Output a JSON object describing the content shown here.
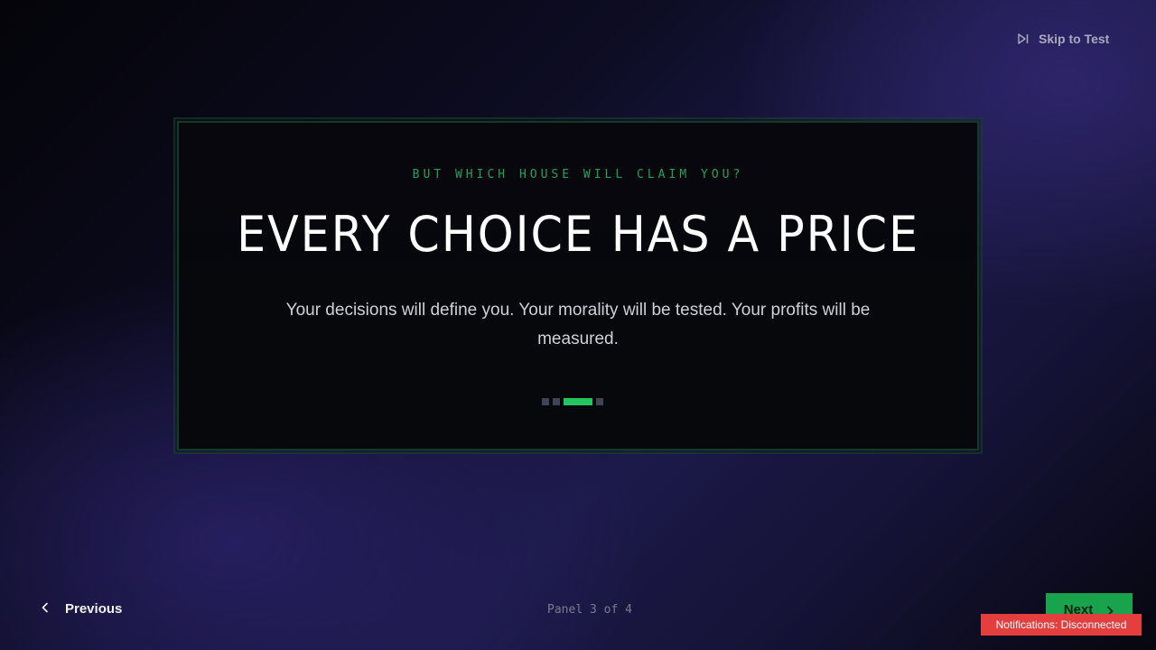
{
  "header": {
    "skip_label": "Skip to Test",
    "skip_icon": "skip-forward-icon"
  },
  "panel": {
    "eyebrow": "BUT WHICH HOUSE WILL CLAIM YOU?",
    "headline": "EVERY CHOICE HAS A PRICE",
    "body": "Your decisions will define you. Your morality will be tested. Your profits will be measured.",
    "current_index": 3,
    "total": 4
  },
  "footer": {
    "previous_label": "Previous",
    "previous_icon": "chevron-left-icon",
    "panel_count": "Panel 3 of 4",
    "next_label": "Next",
    "next_icon": "chevron-right-icon"
  },
  "toast": {
    "notifications": "Notifications: Disconnected"
  },
  "colors": {
    "accent": "#22c55e",
    "eyebrow": "#1fa35a",
    "next_bg": "#19a34c",
    "toast_bg": "#e53e3e",
    "dot_inactive": "#3d4453"
  }
}
